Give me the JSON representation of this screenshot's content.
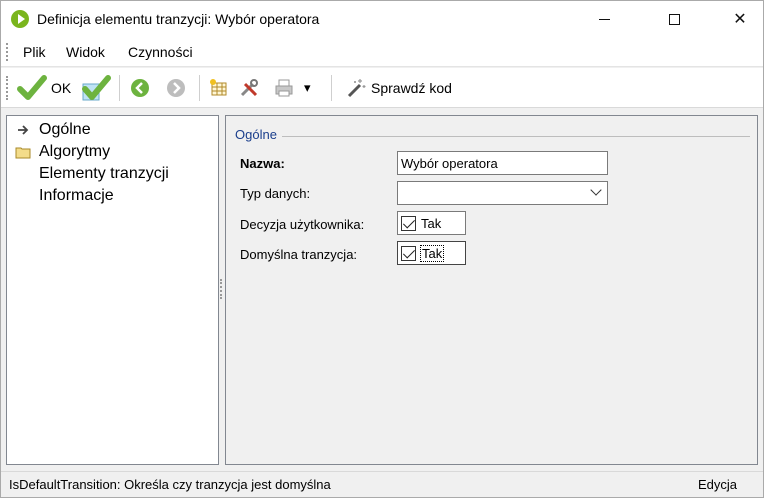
{
  "window": {
    "title": "Definicja elementu tranzycji: Wybór operatora",
    "controls": {
      "minimize": "",
      "maximize": "",
      "close": "✕"
    }
  },
  "menu": {
    "items": [
      "Plik",
      "Widok",
      "Czynności"
    ]
  },
  "toolbar": {
    "ok_label": "OK",
    "check_code_label": "Sprawdź kod",
    "dropdown_glyph": "▾",
    "icons": [
      "check-green-icon",
      "check-cyan-icon",
      "back-circle-icon",
      "forward-circle-icon",
      "grid-icon",
      "tools-icon",
      "printer-icon",
      "magic-wand-icon"
    ],
    "accent_green": "#6db33f"
  },
  "tree": {
    "items": [
      {
        "label": "Ogólne",
        "icon": "arrow-right-icon",
        "selected": true
      },
      {
        "label": "Algorytmy",
        "icon": "folder-icon"
      },
      {
        "label": "Elementy tranzycji",
        "icon": ""
      },
      {
        "label": "Informacje",
        "icon": ""
      }
    ]
  },
  "form": {
    "group_title": "Ogólne",
    "name_label": "Nazwa:",
    "name_value": "Wybór operatora",
    "type_label": "Typ danych:",
    "type_value": "",
    "decision_label": "Decyzja użytkownika:",
    "decision_checkbox_label": "Tak",
    "decision_checked": true,
    "default_label": "Domyślna tranzycja:",
    "default_checkbox_label": "Tak",
    "default_checked": true
  },
  "status": {
    "text": "IsDefaultTransition: Określa czy tranzycja jest domyślna",
    "mode": "Edycja"
  }
}
